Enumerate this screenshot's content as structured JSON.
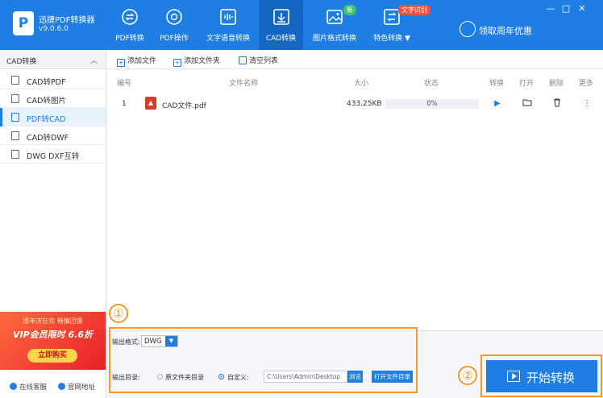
{
  "app": {
    "name": "迅捷PDF转换器",
    "version": "v9.0.6.0",
    "logo_letter": "P"
  },
  "nav": [
    {
      "label": "PDF转换",
      "icon": "pdf-convert-icon"
    },
    {
      "label": "PDF操作",
      "icon": "pdf-operate-icon"
    },
    {
      "label": "文字语音转换",
      "icon": "audio-wave-icon"
    },
    {
      "label": "CAD转换",
      "icon": "cad-download-icon",
      "active": true
    },
    {
      "label": "图片格式转换",
      "icon": "image-icon",
      "badge": "新"
    },
    {
      "label": "特色转换 ▼",
      "icon": "special-convert-icon",
      "badge": "文字识别"
    }
  ],
  "promo": {
    "label": "领取周年优惠"
  },
  "window": {
    "minimize": "—",
    "maximize": "□",
    "close": "✕"
  },
  "sidebar": {
    "header": "CAD转换",
    "chevron": "︿",
    "items": [
      {
        "label": "CAD转PDF"
      },
      {
        "label": "CAD转图片"
      },
      {
        "label": "PDF转CAD",
        "active": true
      },
      {
        "label": "CAD转DWF"
      },
      {
        "label": "DWG DXF互转"
      }
    ],
    "ad": {
      "line1": "周年庆狂欢  畅情回馈",
      "line2": "VIP会员限时 6.6折",
      "button": "立即购买"
    },
    "footer": {
      "service": "在线客服",
      "website": "官网地址"
    }
  },
  "toolbar": {
    "add_file": "添加文件",
    "add_folder": "添加文件夹",
    "clear": "清空列表"
  },
  "table": {
    "headers": {
      "no": "编号",
      "name": "文件名称",
      "size": "大小",
      "status": "状态",
      "convert": "转换",
      "open": "打开",
      "delete": "删除",
      "more": "更多"
    },
    "rows": [
      {
        "no": "1",
        "name": "CAD文件.pdf",
        "size": "433.25KB",
        "progress_text": "0%",
        "progress": 0
      }
    ]
  },
  "settings": {
    "marker": "①",
    "format_label": "输出格式:",
    "format_value": "DWG",
    "dir_label": "输出目录:",
    "opt_source": "原文件夹目录",
    "opt_custom": "自定义:",
    "path": "C:\\Users\\Admin\\Desktop",
    "browse": "浏览",
    "open_dir": "打开文件目录"
  },
  "start": {
    "marker": "②",
    "label": "开始转换"
  },
  "colors": {
    "primary": "#1e7ee4",
    "highlight": "#f39a2b",
    "pdf_red": "#d83b2d"
  }
}
